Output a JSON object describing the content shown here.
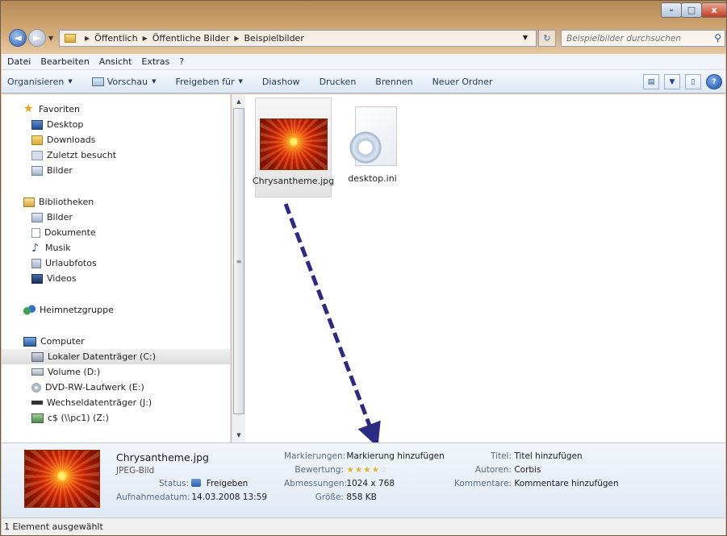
{
  "address": {
    "crumbs": [
      "Öffentlich",
      "Öffentliche Bilder",
      "Beispielbilder"
    ]
  },
  "search": {
    "placeholder": "Beispielbilder durchsuchen"
  },
  "menubar": [
    "Datei",
    "Bearbeiten",
    "Ansicht",
    "Extras",
    "?"
  ],
  "toolbar": {
    "organize": "Organisieren",
    "preview": "Vorschau",
    "share": "Freigeben für",
    "slideshow": "Diashow",
    "print": "Drucken",
    "burn": "Brennen",
    "new_folder": "Neuer Ordner"
  },
  "nav": {
    "favorites": "Favoriten",
    "fav_items": [
      "Desktop",
      "Downloads",
      "Zuletzt besucht",
      "Bilder"
    ],
    "libraries": "Bibliotheken",
    "lib_items": [
      "Bilder",
      "Dokumente",
      "Musik",
      "Urlaubfotos",
      "Videos"
    ],
    "homegroup": "Heimnetzgruppe",
    "computer": "Computer",
    "drives": [
      "Lokaler Datenträger (C:)",
      "Volume (D:)",
      "DVD-RW-Laufwerk (E:)",
      "Wechseldatenträger (J:)",
      "c$ (\\\\pc1) (Z:)"
    ]
  },
  "files": [
    {
      "name": "Chrysantheme.jpg"
    },
    {
      "name": "desktop.ini"
    }
  ],
  "details": {
    "name": "Chrysantheme.jpg",
    "type": "JPEG-Bild",
    "status_label": "Status:",
    "status_value": "Freigeben",
    "date_label": "Aufnahmedatum:",
    "date_value": "14.03.2008 13:59",
    "tags_label": "Markierungen:",
    "tags_value": "Markierung hinzufügen",
    "rating_label": "Bewertung:",
    "rating_stars": 4,
    "dims_label": "Abmessungen:",
    "dims_value": "1024 x 768",
    "size_label": "Größe:",
    "size_value": "858 KB",
    "title_label": "Titel:",
    "title_value": "Titel hinzufügen",
    "authors_label": "Autoren:",
    "authors_value": "Corbis",
    "comments_label": "Kommentare:",
    "comments_value": "Kommentare hinzufügen"
  },
  "status": "1 Element ausgewählt",
  "colors": {
    "arrow": "#2d2a84"
  }
}
